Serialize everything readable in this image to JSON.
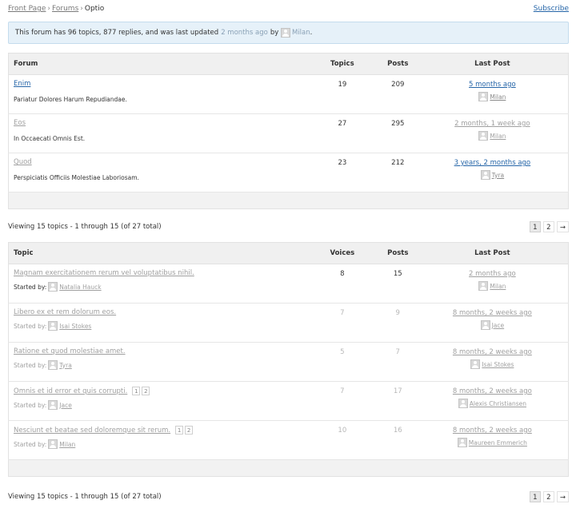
{
  "breadcrumb": {
    "front_page": "Front Page",
    "forums": "Forums",
    "current": "Optio",
    "separator": "›"
  },
  "subscribe_label": "Subscribe",
  "notice": {
    "prefix": "This forum has 96 topics, 877 replies, and was last updated",
    "ago": "2 months ago",
    "by": "by",
    "author": "Milan",
    "suffix": "."
  },
  "forums_table": {
    "headers": {
      "forum": "Forum",
      "topics": "Topics",
      "posts": "Posts",
      "last_post": "Last Post"
    },
    "rows": [
      {
        "name": "Enim",
        "description": "Pariatur Dolores Harum Repudiandae.",
        "topics": "19",
        "posts": "209",
        "last_post": "5 months ago",
        "last_author": "Milan"
      },
      {
        "name": "Eos",
        "description": "In Occaecati Omnis Est.",
        "topics": "27",
        "posts": "295",
        "last_post": "2 months, 1 week ago",
        "last_author": "Milan"
      },
      {
        "name": "Quod",
        "description": "Perspiciatis Officiis Molestiae Laboriosam.",
        "topics": "23",
        "posts": "212",
        "last_post": "3 years, 2 months ago",
        "last_author": "Tyra"
      }
    ]
  },
  "viewing_top": "Viewing 15 topics - 1 through 15 (of 27 total)",
  "viewing_bottom": "Viewing 15 topics - 1 through 15 (of 27 total)",
  "pagination": {
    "page1": "1",
    "page2": "2",
    "next": "→"
  },
  "topics_table": {
    "headers": {
      "topic": "Topic",
      "voices": "Voices",
      "posts": "Posts",
      "last_post": "Last Post"
    },
    "started_by": "Started by:",
    "rows": [
      {
        "title": "Magnam exercitationem rerum vel voluptatibus nihil.",
        "author": "Natalia Hauck",
        "voices": "8",
        "posts": "15",
        "last_post": "2 months ago",
        "last_author": "Milan"
      },
      {
        "title": "Libero ex et rem dolorum eos.",
        "author": "Isai Stokes",
        "voices": "7",
        "posts": "9",
        "last_post": "8 months, 2 weeks ago",
        "last_author": "Jace"
      },
      {
        "title": "Ratione et quod molestiae amet.",
        "author": "Tyra",
        "voices": "5",
        "posts": "7",
        "last_post": "8 months, 2 weeks ago",
        "last_author": "Isai Stokes"
      },
      {
        "title": "Omnis et id error et quis corrupti.",
        "pages": [
          "1",
          "2"
        ],
        "author": "Jace",
        "voices": "7",
        "posts": "17",
        "last_post": "8 months, 2 weeks ago",
        "last_author": "Alexis Christiansen"
      },
      {
        "title": "Nesciunt et beatae sed doloremque sit rerum.",
        "pages": [
          "1",
          "2"
        ],
        "author": "Milan",
        "voices": "10",
        "posts": "16",
        "last_post": "8 months, 2 weeks ago",
        "last_author": "Maureen Emmerich"
      }
    ]
  }
}
